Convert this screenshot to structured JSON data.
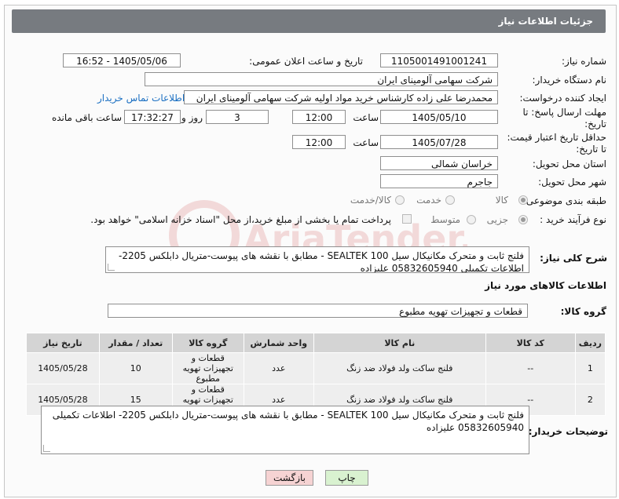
{
  "header": {
    "title": "جزئیات اطلاعات نیاز"
  },
  "form": {
    "need_number_label": "شماره نیاز:",
    "need_number": "1105001491001241",
    "announce_label": "تاریخ و ساعت اعلان عمومی:",
    "announce_value": "1405/05/06 - 16:52",
    "buyer_org_label": "نام دستگاه خریدار:",
    "buyer_org": "شرکت سهامی آلومینای ایران",
    "creator_label": "ایجاد کننده درخواست:",
    "creator": "محمدرضا علی زاده کارشناس خرید مواد اولیه شرکت سهامی آلومینای ایران",
    "buyer_contact_link": "اطلاعات تماس خریدار",
    "deadline_label_1": "مهلت ارسال پاسخ: تا",
    "deadline_label_2": "تاریخ:",
    "deadline_date": "1405/05/10",
    "time_label": "ساعت",
    "deadline_time": "12:00",
    "days_value": "3",
    "days_label": "روز و",
    "remaining_time": "17:32:27",
    "remaining_label": "ساعت باقی مانده",
    "validity_label_1": "حداقل تاریخ اعتبار قیمت:",
    "validity_label_2": "تا تاریخ:",
    "validity_date": "1405/07/28",
    "validity_time": "12:00",
    "province_label": "استان محل تحویل:",
    "province": "خراسان شمالی",
    "city_label": "شهر محل تحویل:",
    "city": "جاجرم",
    "category_label": "طبقه بندی موضوعی:",
    "category_options": [
      "کالا",
      "خدمت",
      "کالا/خدمت"
    ],
    "category_selected": "کالا",
    "process_label": "نوع فرآیند خرید :",
    "process_options": [
      "جزیی",
      "متوسط"
    ],
    "process_selected": "جزیی",
    "payment_note": "پرداخت تمام یا بخشی از مبلغ خرید،از محل \"اسناد خزانه اسلامی\" خواهد بود."
  },
  "description": {
    "label": "شرح کلی نیاز:",
    "text": "فلنج ثابت و متحرک مکانیکال سیل SEALTEK 100 - مطابق با نقشه های پیوست-متریال دابلکس 2205- اطلاعات تکمیلی 05832605940 علیزاده"
  },
  "goods": {
    "section_title": "اطلاعات کالاهای مورد نیاز",
    "group_label": "گروه کالا:",
    "group_value": "قطعات و تجهیزات تهویه مطبوع",
    "columns": [
      "ردیف",
      "کد کالا",
      "نام کالا",
      "واحد شمارش",
      "گروه کالا",
      "تعداد / مقدار",
      "تاریخ نیاز"
    ],
    "rows": [
      [
        "1",
        "--",
        "فلنج ساکت ولد فولاد ضد زنگ",
        "عدد",
        "قطعات و تجهیزات تهویه مطبوع",
        "10",
        "1405/05/28"
      ],
      [
        "2",
        "--",
        "فلنج ساکت ولد فولاد ضد زنگ",
        "عدد",
        "قطعات و تجهیزات تهویه مطبوع",
        "15",
        "1405/05/28"
      ]
    ]
  },
  "buyer_notes": {
    "label": "توضیحات خریدار:",
    "text": "فلنج ثابت و متحرک مکانیکال سیل SEALTEK 100 - مطابق با نقشه های پیوست-متریال دابلکس 2205- اطلاعات تکمیلی 05832605940 علیزاده"
  },
  "buttons": {
    "print": "چاپ",
    "back": "بازگشت"
  },
  "colors": {
    "header_bg": "#777b80",
    "link": "#1a6fc2",
    "back_bg": "#f6d3d3",
    "print_bg": "#d9f2d0"
  },
  "watermark_text": "AriaTender.neT"
}
